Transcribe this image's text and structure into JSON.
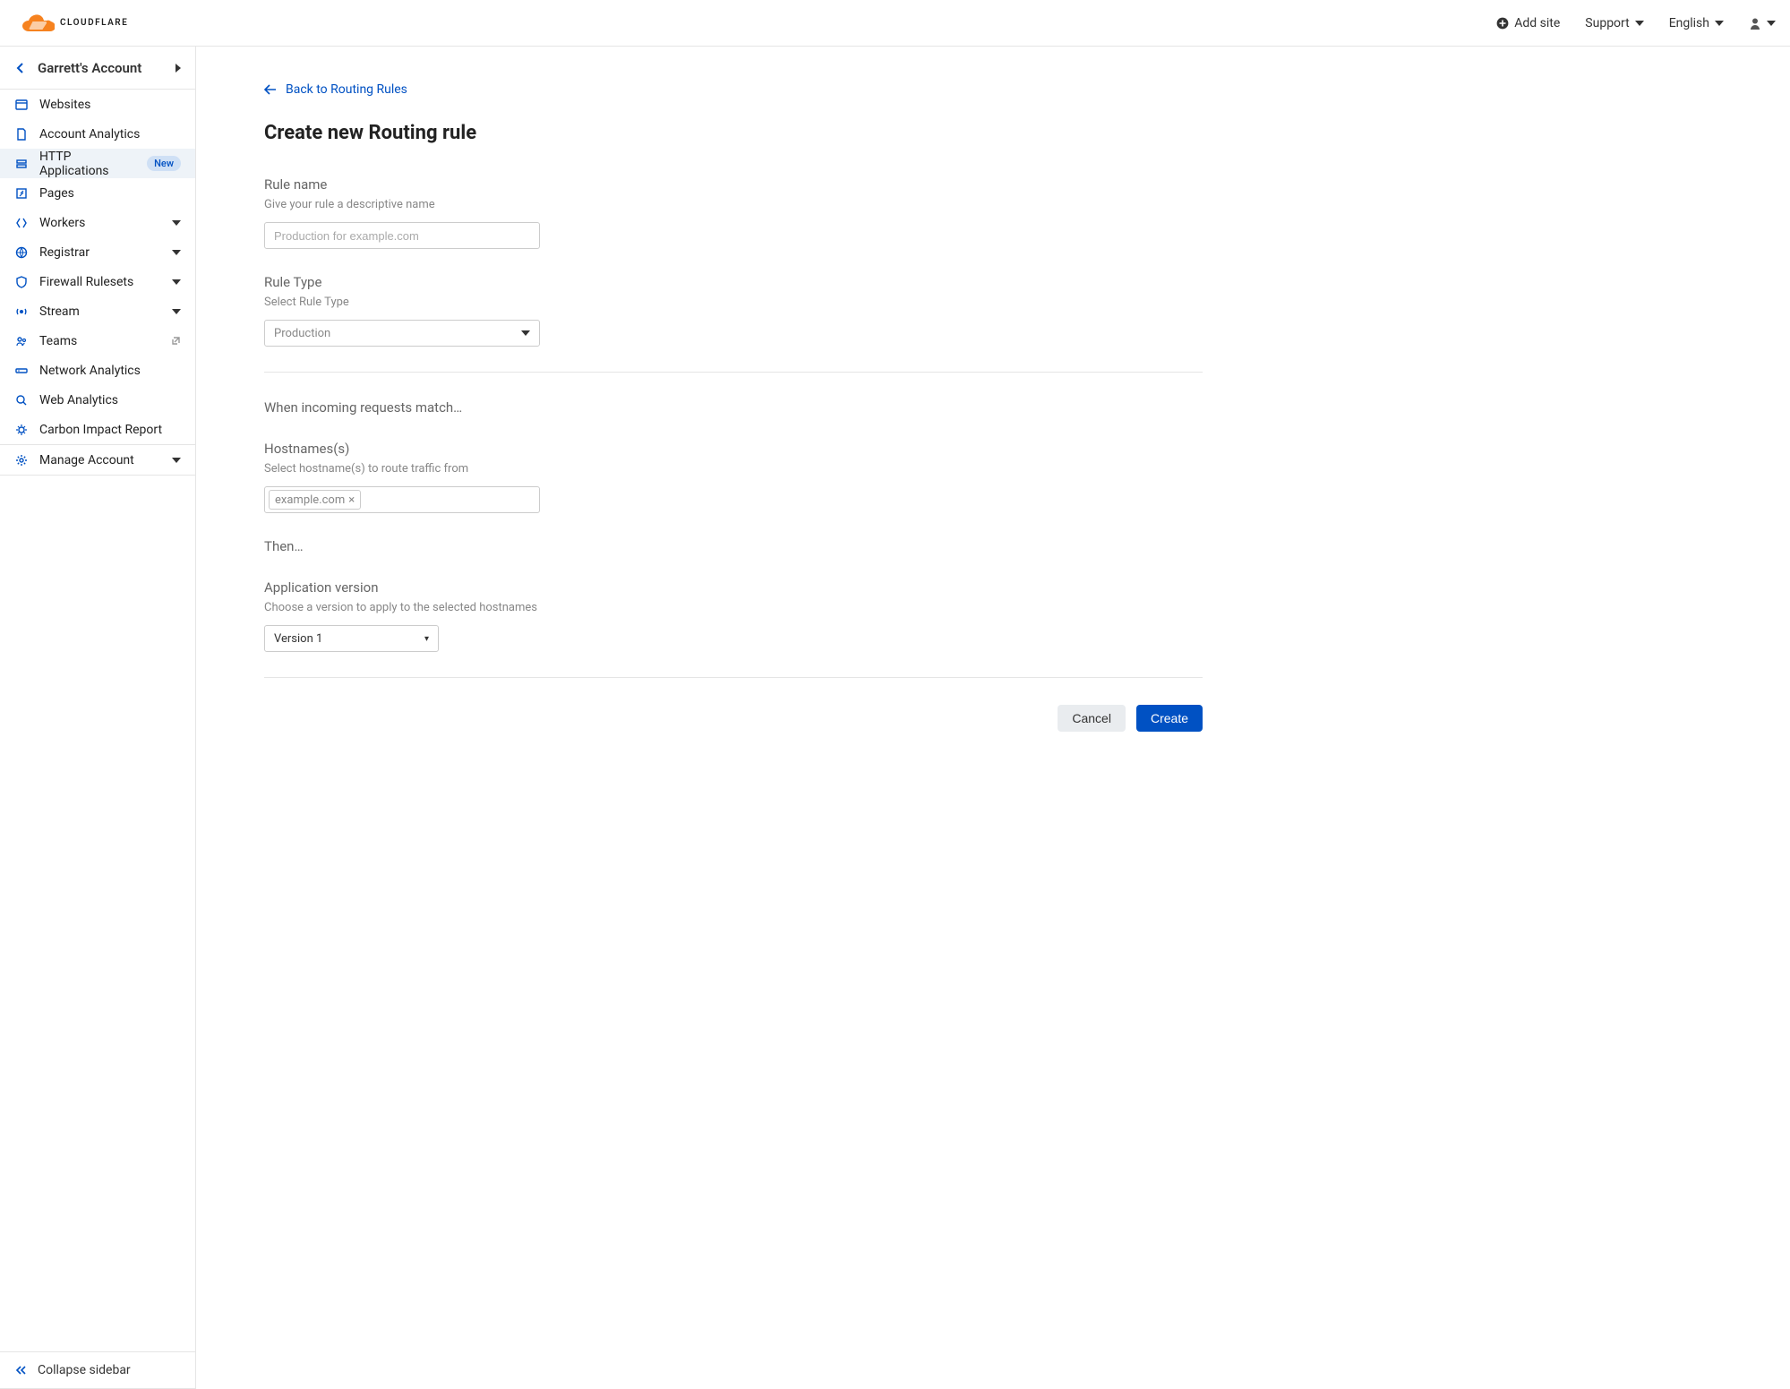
{
  "topbar": {
    "add_site": "Add site",
    "support": "Support",
    "language": "English"
  },
  "sidebar": {
    "account_label": "Garrett's Account",
    "items": {
      "websites": "Websites",
      "account_analytics": "Account Analytics",
      "http_applications": "HTTP Applications",
      "http_applications_badge": "New",
      "pages": "Pages",
      "workers": "Workers",
      "registrar": "Registrar",
      "firewall_rulesets": "Firewall Rulesets",
      "stream": "Stream",
      "teams": "Teams",
      "network_analytics": "Network Analytics",
      "web_analytics": "Web Analytics",
      "carbon_impact": "Carbon Impact Report",
      "manage_account": "Manage Account"
    },
    "collapse": "Collapse sidebar"
  },
  "main": {
    "back_link": "Back to Routing Rules",
    "title": "Create new Routing rule",
    "rule_name": {
      "label": "Rule name",
      "help": "Give your rule a descriptive name",
      "placeholder": "Production for example.com"
    },
    "rule_type": {
      "label": "Rule Type",
      "help": "Select Rule Type",
      "value": "Production"
    },
    "match_header": "When incoming requests match…",
    "hostnames": {
      "label": "Hostnames(s)",
      "help": "Select hostname(s) to route traffic from",
      "tags": [
        "example.com"
      ]
    },
    "then_header": "Then…",
    "app_version": {
      "label": "Application version",
      "help": "Choose a version to apply to the selected hostnames",
      "value": "Version 1"
    },
    "cancel": "Cancel",
    "create": "Create"
  }
}
